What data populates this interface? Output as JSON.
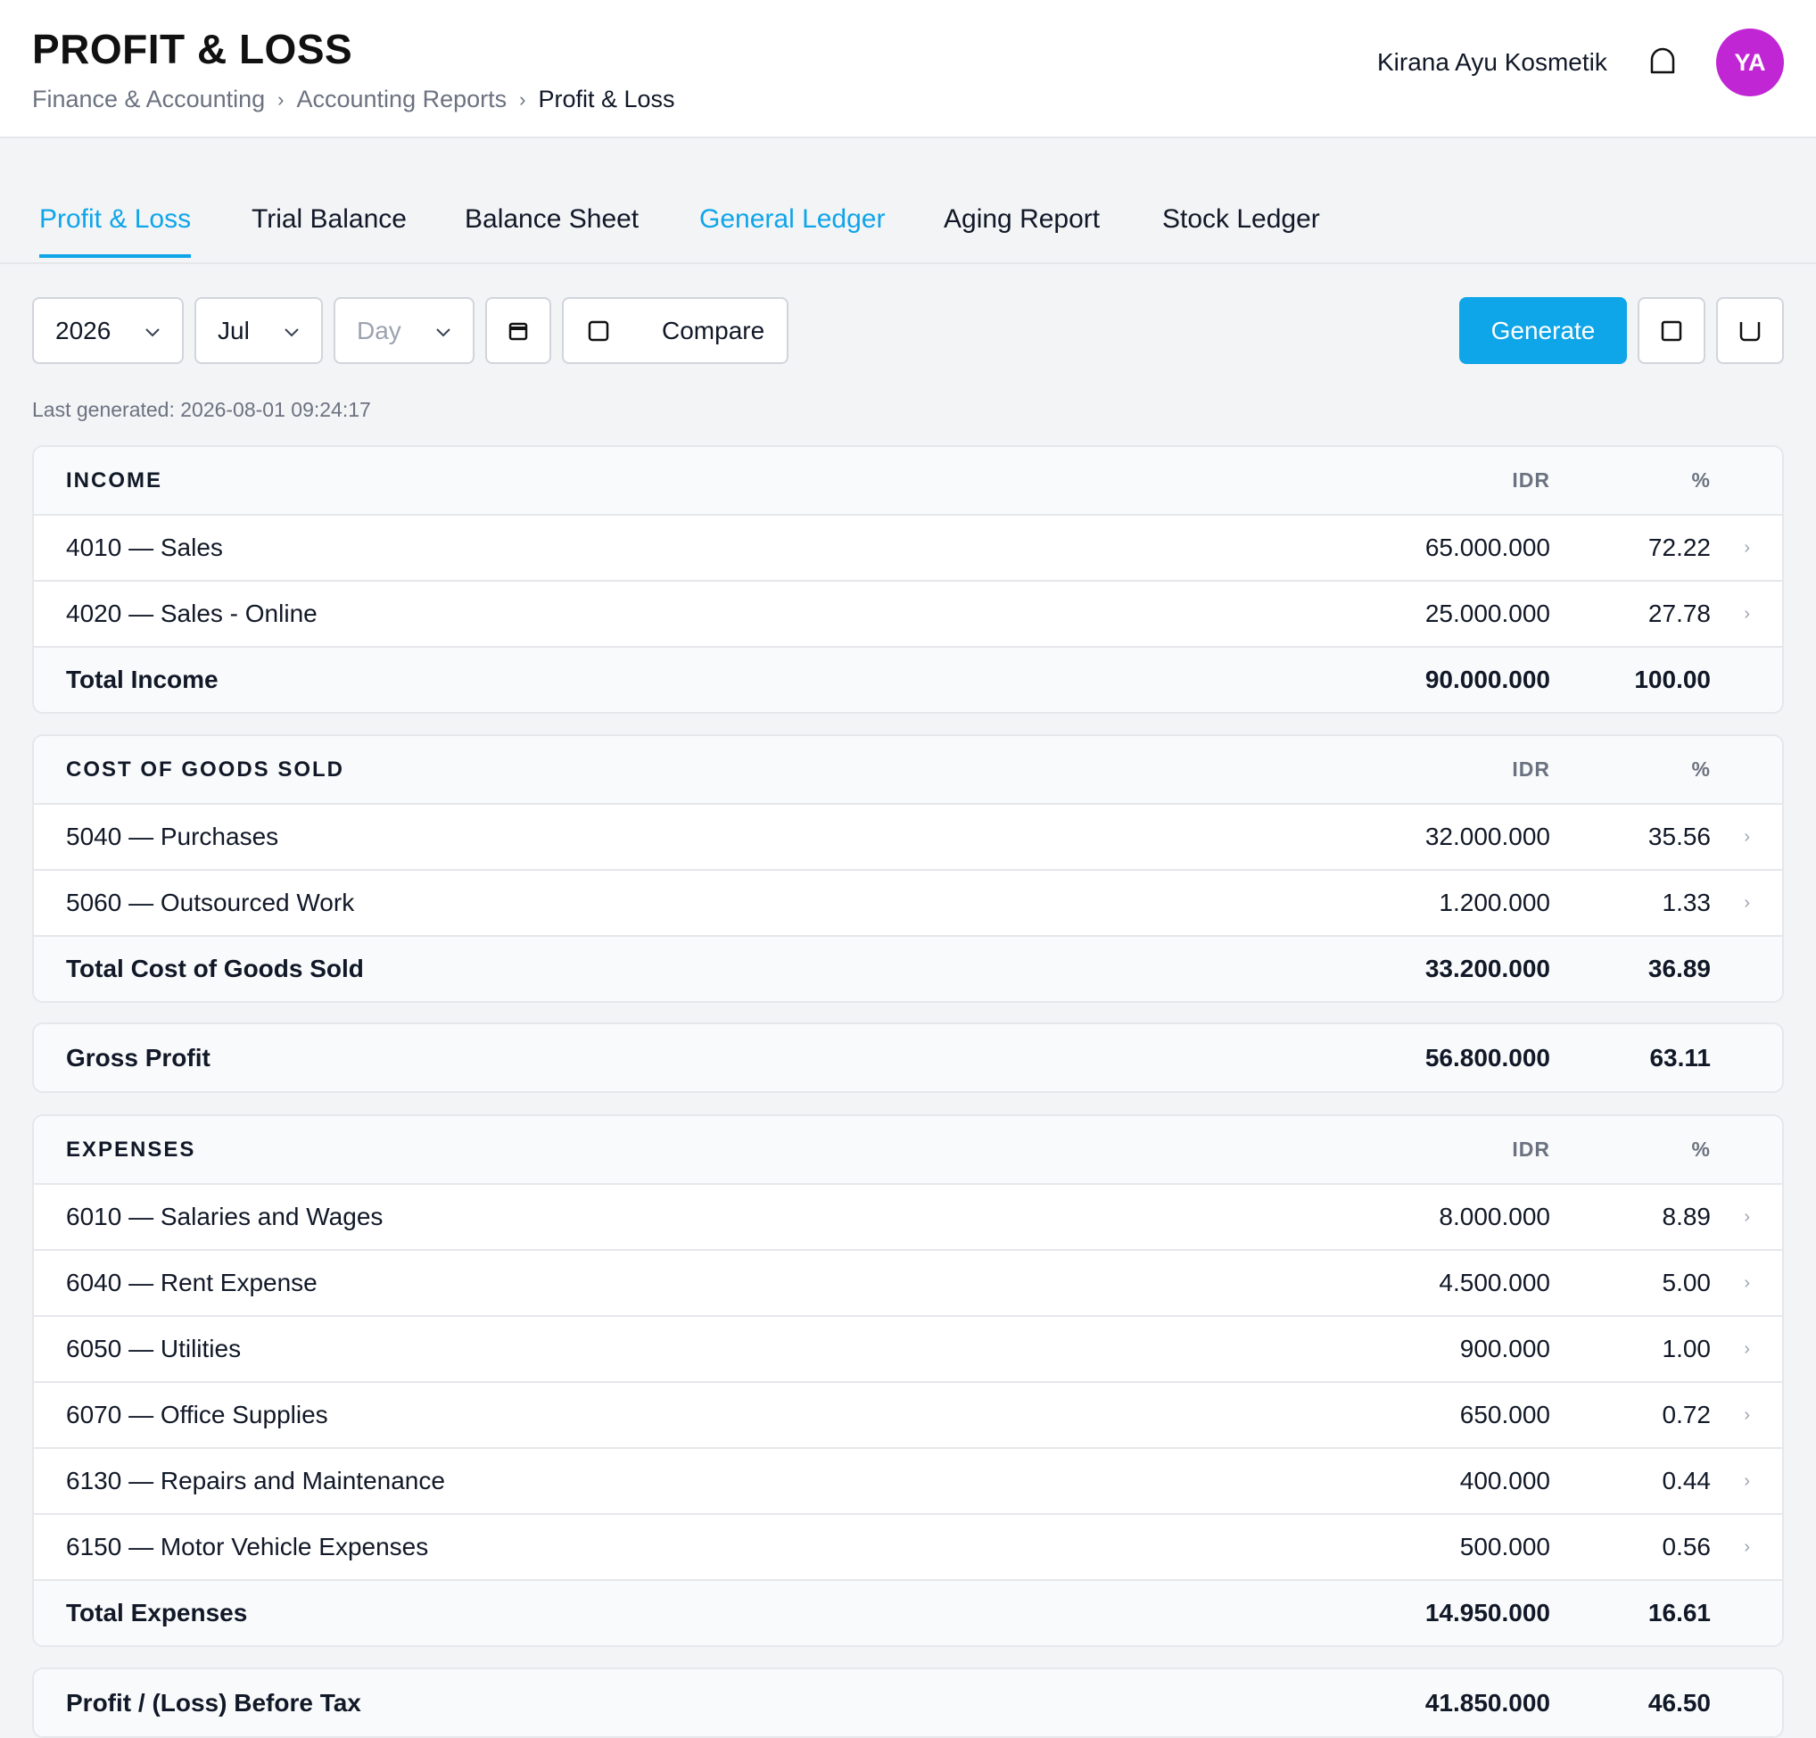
{
  "header": {
    "title": "PROFIT & LOSS",
    "breadcrumb": [
      "Finance & Accounting",
      "Accounting Reports",
      "Profit & Loss"
    ],
    "company": "Kirana Ayu Kosmetik",
    "avatar_initials": "YA",
    "notification_icon": "bell-icon"
  },
  "tabs": [
    "Profit & Loss",
    "Trial Balance",
    "Balance Sheet",
    "General Ledger",
    "Aging Report",
    "Stock Ledger"
  ],
  "toolbar": {
    "year": "2026",
    "month": "Jul",
    "day_placeholder": "Day",
    "compare_label": "Compare",
    "generate_label": "Generate",
    "last_generated": "Last generated: 2026-08-01 09:24:17"
  },
  "columns": {
    "amount": "IDR",
    "percent": "%"
  },
  "income": {
    "title": "INCOME",
    "rows": [
      {
        "label": "4010 — Sales",
        "amount": "65.000.000",
        "pct": "72.22"
      },
      {
        "label": "4020 — Sales - Online",
        "amount": "25.000.000",
        "pct": "27.78"
      }
    ],
    "total": {
      "label": "Total Income",
      "amount": "90.000.000",
      "pct": "100.00"
    }
  },
  "cogs": {
    "title": "COST OF GOODS SOLD",
    "rows": [
      {
        "label": "5040 — Purchases",
        "amount": "32.000.000",
        "pct": "35.56"
      },
      {
        "label": "5060 — Outsourced Work",
        "amount": "1.200.000",
        "pct": "1.33"
      }
    ],
    "total": {
      "label": "Total Cost of Goods Sold",
      "amount": "33.200.000",
      "pct": "36.89"
    }
  },
  "gross_profit": {
    "label": "Gross Profit",
    "amount": "56.800.000",
    "pct": "63.11"
  },
  "expenses": {
    "title": "EXPENSES",
    "rows": [
      {
        "label": "6010 — Salaries and Wages",
        "amount": "8.000.000",
        "pct": "8.89"
      },
      {
        "label": "6040 — Rent Expense",
        "amount": "4.500.000",
        "pct": "5.00"
      },
      {
        "label": "6050 — Utilities",
        "amount": "900.000",
        "pct": "1.00"
      },
      {
        "label": "6070 — Office Supplies",
        "amount": "650.000",
        "pct": "0.72"
      },
      {
        "label": "6130 — Repairs and Maintenance",
        "amount": "400.000",
        "pct": "0.44"
      },
      {
        "label": "6150 — Motor Vehicle Expenses",
        "amount": "500.000",
        "pct": "0.56"
      }
    ],
    "total": {
      "label": "Total Expenses",
      "amount": "14.950.000",
      "pct": "16.61"
    }
  },
  "profit_before_tax": {
    "label": "Profit / (Loss) Before Tax",
    "amount": "41.850.000",
    "pct": "46.50"
  },
  "colors": {
    "accent": "#0ea5e9",
    "avatar": "#c026d3",
    "border": "#e5e7eb",
    "muted": "#6b7280"
  }
}
